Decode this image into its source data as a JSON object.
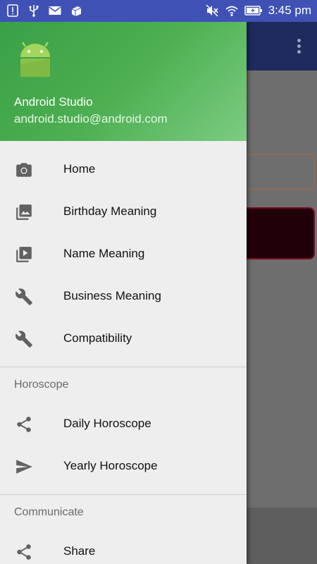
{
  "status_bar": {
    "time": "3:45 pm",
    "left_icons": [
      "alert-icon",
      "usb-icon",
      "mail-icon",
      "app-icon"
    ],
    "right_icons": [
      "mute-icon",
      "wifi-icon",
      "battery-icon"
    ]
  },
  "drawer": {
    "header": {
      "name": "Android Studio",
      "email": "android.studio@android.com",
      "avatar_icon": "android-logo-icon"
    },
    "primary_items": [
      {
        "label": "Home",
        "icon": "camera-icon"
      },
      {
        "label": "Birthday Meaning",
        "icon": "gallery-icon"
      },
      {
        "label": "Name Meaning",
        "icon": "slideshow-icon"
      },
      {
        "label": "Business Meaning",
        "icon": "wrench-icon"
      },
      {
        "label": "Compatibility",
        "icon": "wrench-icon"
      }
    ],
    "sections": [
      {
        "title": "Horoscope",
        "items": [
          {
            "label": "Daily Horoscope",
            "icon": "share-icon"
          },
          {
            "label": "Yearly Horoscope",
            "icon": "send-icon"
          }
        ]
      },
      {
        "title": "Communicate",
        "items": [
          {
            "label": "Share",
            "icon": "share-icon"
          }
        ]
      }
    ]
  },
  "colors": {
    "status_bar": "#3f51b5",
    "header_green": "#4caf50",
    "drawer_bg": "#eeeeee",
    "icon_gray": "#616161"
  }
}
